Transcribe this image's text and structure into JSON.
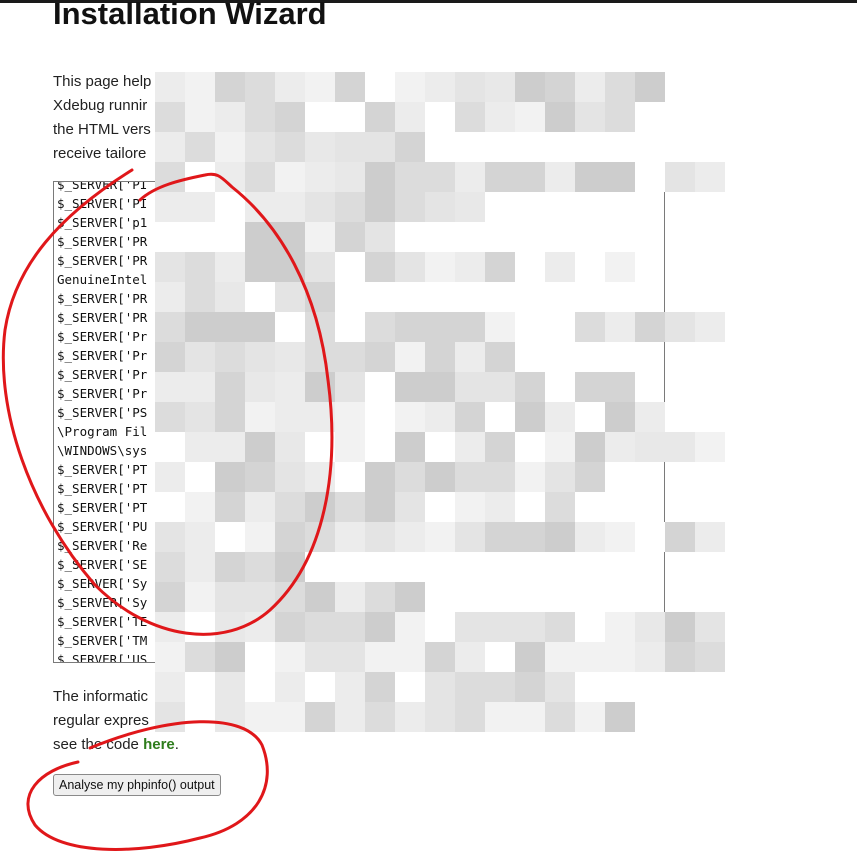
{
  "page": {
    "title": "Installation Wizard"
  },
  "intro": {
    "lines": [
      "This page help",
      "Xdebug runnir",
      "the HTML vers",
      "receive tailore"
    ]
  },
  "phpinfo_textarea": {
    "lines": [
      "$_SERVER['PI",
      "$_SERVER['PI",
      "$_SERVER['p1",
      "$_SERVER['PR",
      "$_SERVER['PR",
      "GenuineIntel",
      "$_SERVER['PR",
      "$_SERVER['PR",
      "$_SERVER['Pr",
      "$_SERVER['Pr",
      "$_SERVER['Pr",
      "$_SERVER['Pr",
      "$_SERVER['PS",
      "\\Program Fil",
      "\\WINDOWS\\sys",
      "$_SERVER['PT",
      "$_SERVER['PT",
      "$_SERVER['PT",
      "$_SERVER['PU",
      "$_SERVER['Re",
      "$_SERVER['SE",
      "$_SERVER['Sy",
      "$_SERVER['Sy",
      "$_SERVER['TE",
      "$_SERVER['TM",
      "$_SERVER['US"
    ]
  },
  "footer": {
    "line1": "The informatic",
    "line2": "regular expres",
    "line3_prefix": "see the code ",
    "link_label": "here",
    "line3_suffix": "."
  },
  "actions": {
    "analyse_button": "Analyse my phpinfo() output"
  },
  "colors": {
    "link": "#2e7d1c",
    "annotation": "#e0171a"
  }
}
